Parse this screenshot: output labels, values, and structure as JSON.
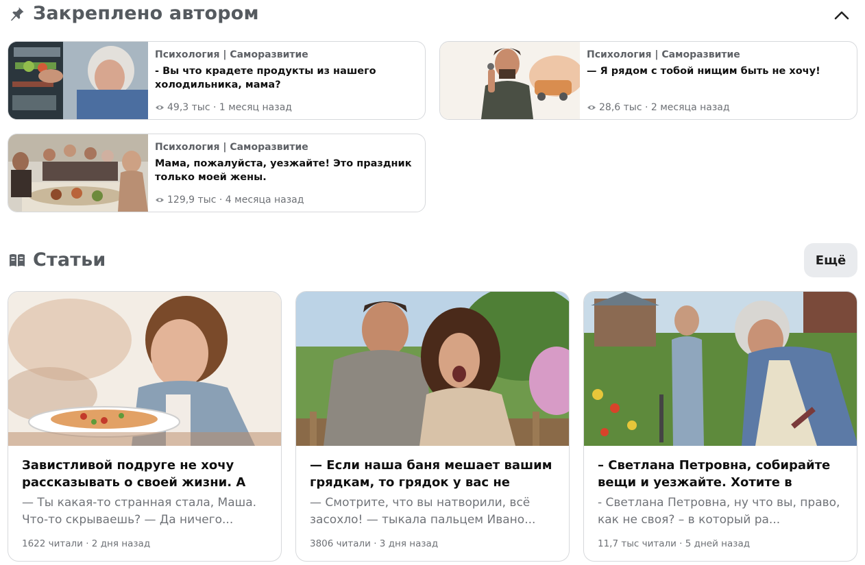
{
  "pinned": {
    "title": "Закреплено автором",
    "items": [
      {
        "channel": "Психология | Саморазвитие",
        "title": "- Вы что крадете продукты из нашего холодильника, мама?",
        "views": "49,3 тыс",
        "age": "1 месяц назад"
      },
      {
        "channel": "Психология | Саморазвитие",
        "title": "— Я рядом с тобой нищим быть не хочу!",
        "views": "28,6 тыс",
        "age": "2 месяца назад"
      },
      {
        "channel": "Психология | Саморазвитие",
        "title": "Мама, пожалуйста, уезжайте! Это праздник только моей жены.",
        "views": "129,9 тыс",
        "age": "4 месяца назад"
      }
    ]
  },
  "articles": {
    "title": "Статьи",
    "more_label": "Ещё",
    "items": [
      {
        "title": "Завистливой подруге не хочу рассказывать о своей жизни. А он...",
        "snippet": "— Ты какая-то странная стала, Маша. Что-то скрываешь? — Да ничего...",
        "meta": "1622 читали · 2 дня назад"
      },
      {
        "title": "— Если наша баня мешает вашим грядкам, то грядок у вас не будет!",
        "snippet": "— Смотрите, что вы натворили, всё засохло! — тыкала пальцем Ивано...",
        "meta": "3806 читали · 3 дня назад"
      },
      {
        "title": "– Светлана Петровна, собирайте вещи и уезжайте. Хотите в земле...",
        "snippet": "- Светлана Петровна, ну что вы, право, как не своя? – в который ра...",
        "meta": "11,7 тыс читали · 5 дней назад"
      }
    ]
  },
  "icons": {
    "pinned": "pin-icon",
    "articles": "open-book-icon",
    "collapse": "chevron-up-icon",
    "views": "eye-icon"
  }
}
